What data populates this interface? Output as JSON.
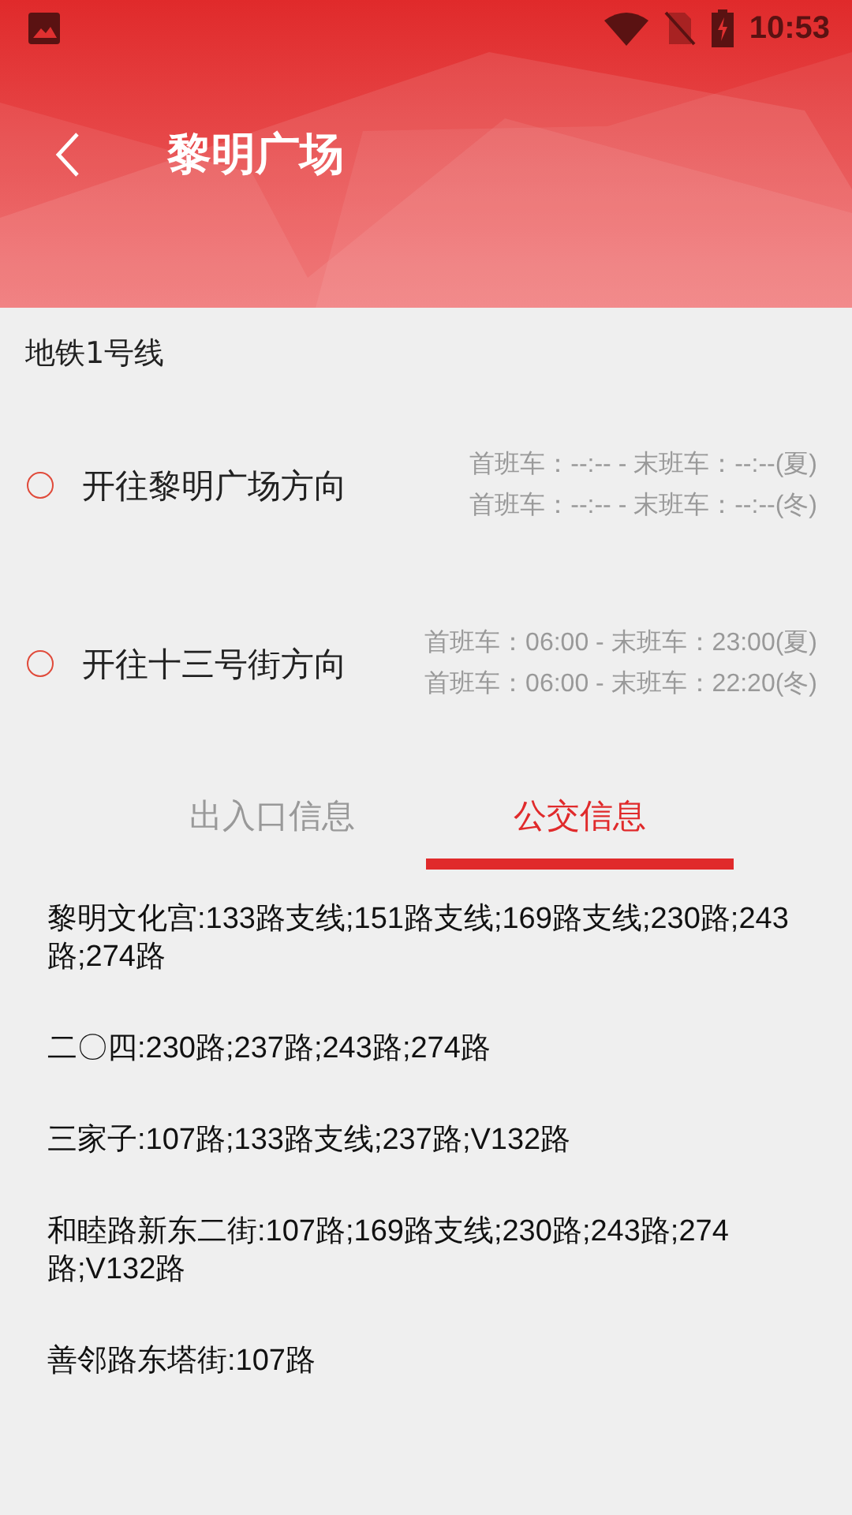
{
  "status_bar": {
    "time": "10:53"
  },
  "header": {
    "title": "黎明广场"
  },
  "line": {
    "name": "地铁1号线"
  },
  "directions": [
    {
      "label": "开往黎明广场方向",
      "selected": false,
      "times": [
        "首班车：--:-- - 末班车：--:--(夏)",
        "首班车：--:-- - 末班车：--:--(冬)"
      ]
    },
    {
      "label": "开往十三号街方向",
      "selected": false,
      "times": [
        "首班车：06:00 - 末班车：23:00(夏)",
        "首班车：06:00 - 末班车：22:20(冬)"
      ]
    }
  ],
  "tabs": [
    {
      "label": "出入口信息",
      "selected": false
    },
    {
      "label": "公交信息",
      "selected": true
    }
  ],
  "bus_stops": [
    "黎明文化宫:133路支线;151路支线;169路支线;230路;243路;274路",
    "二〇四:230路;237路;243路;274路",
    "三家子:107路;133路支线;237路;V132路",
    "和睦路新东二街:107路;169路支线;230路;243路;274路;V132路",
    "善邻路东塔街:107路"
  ]
}
